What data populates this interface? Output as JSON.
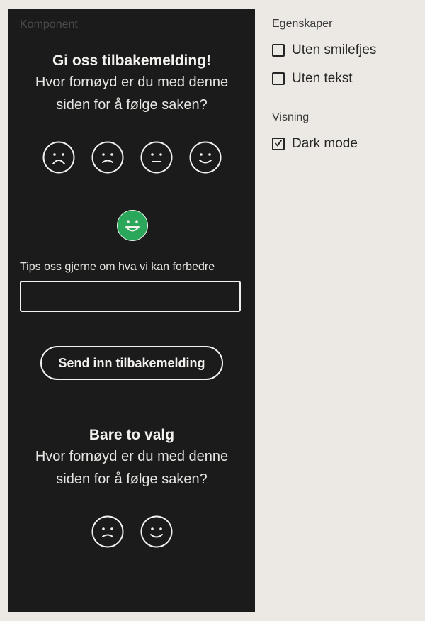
{
  "panel": {
    "label": "Komponent"
  },
  "feedback1": {
    "title": "Gi oss tilbakemelding!",
    "question_line1": "Hvor fornøyd er du med denne",
    "question_line2": "siden for å følge saken?",
    "faces": [
      "very-sad-face",
      "sad-face",
      "neutral-face",
      "happy-face"
    ],
    "selected_face": "very-happy-face",
    "tips_label": "Tips oss gjerne om hva vi kan forbedre",
    "tips_value": "",
    "send_label": "Send inn tilbakemelding",
    "selected_color": "#2aa75a"
  },
  "feedback2": {
    "title": "Bare to valg",
    "question_line1": "Hvor fornøyd er du med denne",
    "question_line2": "siden for å følge saken?",
    "faces": [
      "sad-face",
      "happy-face"
    ]
  },
  "properties": {
    "heading": "Egenskaper",
    "options": [
      {
        "label": "Uten smilefjes",
        "checked": false
      },
      {
        "label": "Uten tekst",
        "checked": false
      }
    ]
  },
  "view": {
    "heading": "Visning",
    "options": [
      {
        "label": "Dark mode",
        "checked": true
      }
    ]
  }
}
